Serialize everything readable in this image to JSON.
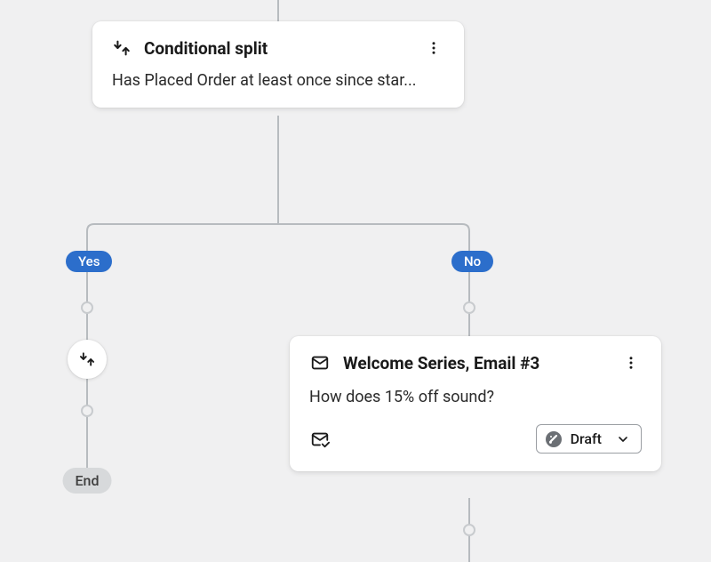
{
  "split_card": {
    "title": "Conditional split",
    "description": "Has Placed Order at least once since star..."
  },
  "branches": {
    "yes_label": "Yes",
    "no_label": "No",
    "end_label": "End"
  },
  "email_card": {
    "title": "Welcome Series, Email #3",
    "subject": "How does 15% off sound?",
    "status": "Draft"
  }
}
